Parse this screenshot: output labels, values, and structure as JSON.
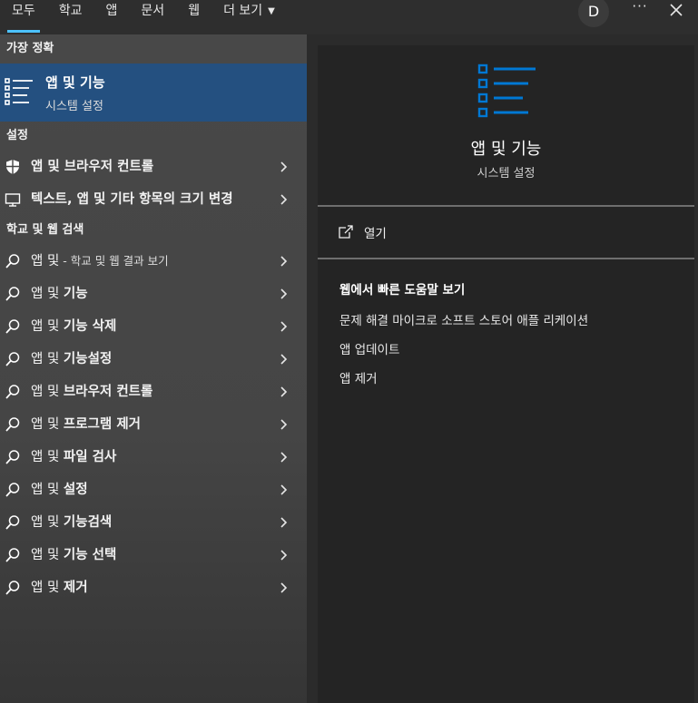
{
  "tabs": [
    {
      "label": "모두"
    },
    {
      "label": "학교"
    },
    {
      "label": "앱"
    },
    {
      "label": "문서"
    },
    {
      "label": "웹"
    },
    {
      "label": "더 보기"
    }
  ],
  "account": {
    "initial": "D"
  },
  "more_label": "···",
  "left": {
    "best_match_header": "가장 정확",
    "best_match": {
      "title": "앱 및 기능",
      "subtitle": "시스템 설정"
    },
    "settings_header": "설정",
    "settings_items": [
      {
        "label": "앱 및 브라우저 컨트롤",
        "icon": "shield-icon"
      },
      {
        "label": "텍스트, 앱 및 기타 항목의 크기 변경",
        "icon": "display-icon"
      }
    ],
    "web_header": "학교 및 웹 검색",
    "web_first": {
      "query": "앱 및",
      "suffix": " - 학교 및 웹 결과 보기"
    },
    "web_items": [
      {
        "prefix": "앱 및",
        "bold": "기능"
      },
      {
        "prefix": "앱 및",
        "bold": "기능 삭제"
      },
      {
        "prefix": "앱 및",
        "bold": "기능설정"
      },
      {
        "prefix": "앱 및",
        "bold": "브라우저 컨트롤"
      },
      {
        "prefix": "앱 및",
        "bold": "프로그램 제거"
      },
      {
        "prefix": "앱 및",
        "bold": "파일 검사"
      },
      {
        "prefix": "앱 및",
        "bold": "설정"
      },
      {
        "prefix": "앱 및",
        "bold": "기능검색"
      },
      {
        "prefix": "앱 및",
        "bold": "기능 선택"
      },
      {
        "prefix": "앱 및",
        "bold": "제거"
      }
    ]
  },
  "right": {
    "title": "앱 및 기능",
    "subtitle": "시스템 설정",
    "open_label": "열기",
    "help_header": "웹에서 빠른 도움말 보기",
    "help_links": [
      "문제 해결 마이크로 소프트 스토어 애플 리케이션",
      "앱 업데이트",
      "앱 제거"
    ]
  },
  "colors": {
    "accent": "#0078d4",
    "selected_bg": "#245080",
    "tab_underline": "#4cc2ff"
  }
}
